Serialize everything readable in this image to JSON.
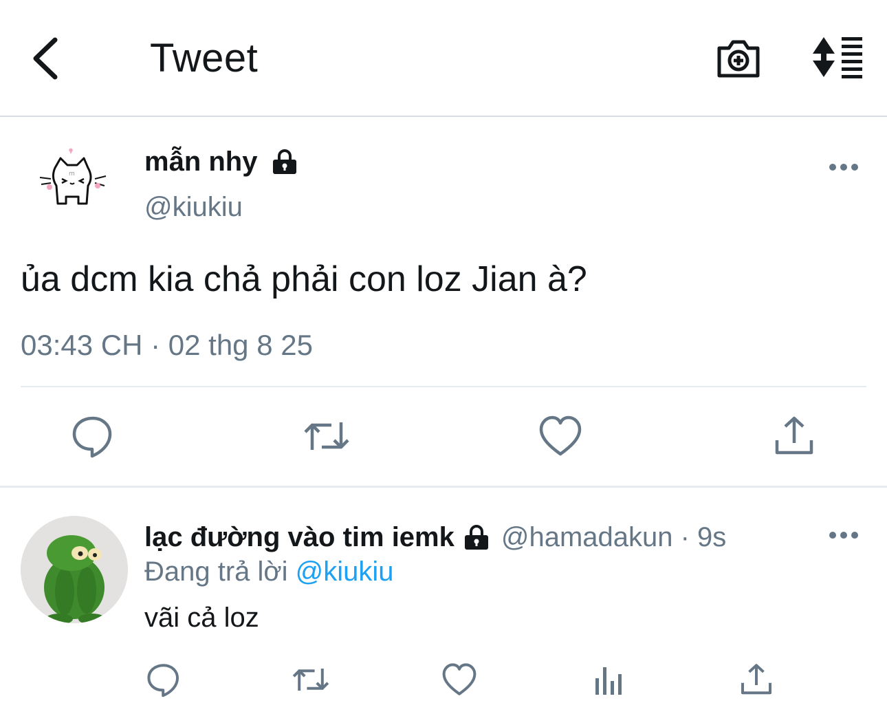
{
  "header": {
    "title": "Tweet",
    "back_icon": "chevron-left-icon",
    "camera_icon": "camera-plus-icon",
    "sort_icon": "sort-list-icon"
  },
  "main_tweet": {
    "display_name": "mẫn nhy",
    "handle": "@kiukiu",
    "text": "ủa dcm kia chả phải con loz Jian à?",
    "timestamp": "03:43 CH · 02 thg 8 25",
    "protected_icon": "lock-icon",
    "actions": [
      "reply-icon",
      "retweet-icon",
      "like-icon",
      "share-icon"
    ]
  },
  "reply": {
    "display_name": "lạc đường vào tim iemk",
    "handle_time": "@hamadakun · 9s",
    "replying_to_label": "Đang trả lời",
    "replying_to_handle": "@kiukiu",
    "text": "vãi cả loz",
    "actions": [
      "reply-icon",
      "retweet-icon",
      "like-icon",
      "analytics-icon",
      "share-icon"
    ]
  },
  "colors": {
    "text_primary": "#14171a",
    "text_secondary": "#657786",
    "link": "#1da1f2",
    "icon": "#657786",
    "divider": "#e6ecf0"
  }
}
